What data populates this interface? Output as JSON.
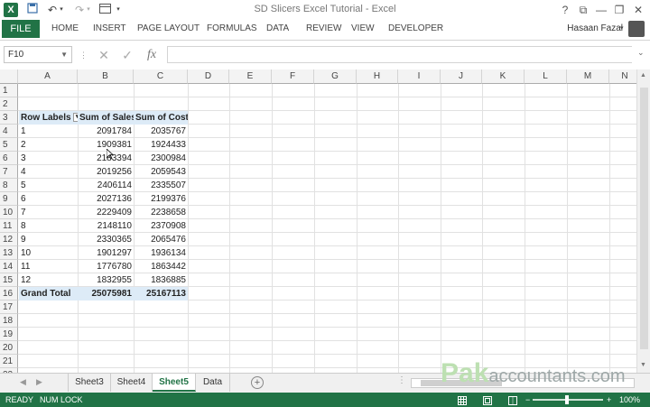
{
  "window": {
    "title": "SD Slicers Excel Tutorial - Excel",
    "app_logo": "X",
    "qat_icons": [
      "save-icon",
      "undo-icon",
      "redo-icon",
      "customize-icon"
    ],
    "controls": [
      "help-icon",
      "ribbon-display-icon",
      "minimize-icon",
      "restore-icon",
      "close-icon"
    ]
  },
  "ribbon": {
    "file_label": "FILE",
    "tabs": [
      "HOME",
      "INSERT",
      "PAGE LAYOUT",
      "FORMULAS",
      "DATA",
      "REVIEW",
      "VIEW",
      "DEVELOPER"
    ],
    "user_name": "Hasaan Fazal"
  },
  "formula_bar": {
    "name_box": "F10",
    "cancel": "✕",
    "enter": "✓",
    "fx": "fx",
    "content": ""
  },
  "columns": [
    "A",
    "B",
    "C",
    "D",
    "E",
    "F",
    "G",
    "H",
    "I",
    "J",
    "K",
    "L",
    "M",
    "N"
  ],
  "rows": [
    "1",
    "2",
    "3",
    "4",
    "5",
    "6",
    "7",
    "8",
    "9",
    "10",
    "11",
    "12",
    "13",
    "14",
    "15",
    "16",
    "17",
    "18",
    "19",
    "20",
    "21",
    "22"
  ],
  "pivot": {
    "headers": [
      "Row Labels",
      "Sum of Sales",
      "Sum of Cost"
    ],
    "data": [
      [
        "1",
        "2091784",
        "2035767"
      ],
      [
        "2",
        "1909381",
        "1924433"
      ],
      [
        "3",
        "2183394",
        "2300984"
      ],
      [
        "4",
        "2019256",
        "2059543"
      ],
      [
        "5",
        "2406114",
        "2335507"
      ],
      [
        "6",
        "2027136",
        "2199376"
      ],
      [
        "7",
        "2229409",
        "2238658"
      ],
      [
        "8",
        "2148110",
        "2370908"
      ],
      [
        "9",
        "2330365",
        "2065476"
      ],
      [
        "10",
        "1901297",
        "1936134"
      ],
      [
        "11",
        "1776780",
        "1863442"
      ],
      [
        "12",
        "1832955",
        "1836885"
      ]
    ],
    "total": [
      "Grand Total",
      "25075981",
      "25167113"
    ]
  },
  "sheets": {
    "tabs": [
      "Sheet3",
      "Sheet4",
      "Sheet5",
      "Data"
    ],
    "active": "Sheet5"
  },
  "watermark": {
    "brand": "Pak",
    "suffix": "accountants.com"
  },
  "status": {
    "ready": "READY",
    "num_lock": "NUM LOCK",
    "zoom": "100%",
    "views": [
      "normal-view-icon",
      "page-layout-view-icon",
      "page-break-view-icon"
    ]
  }
}
